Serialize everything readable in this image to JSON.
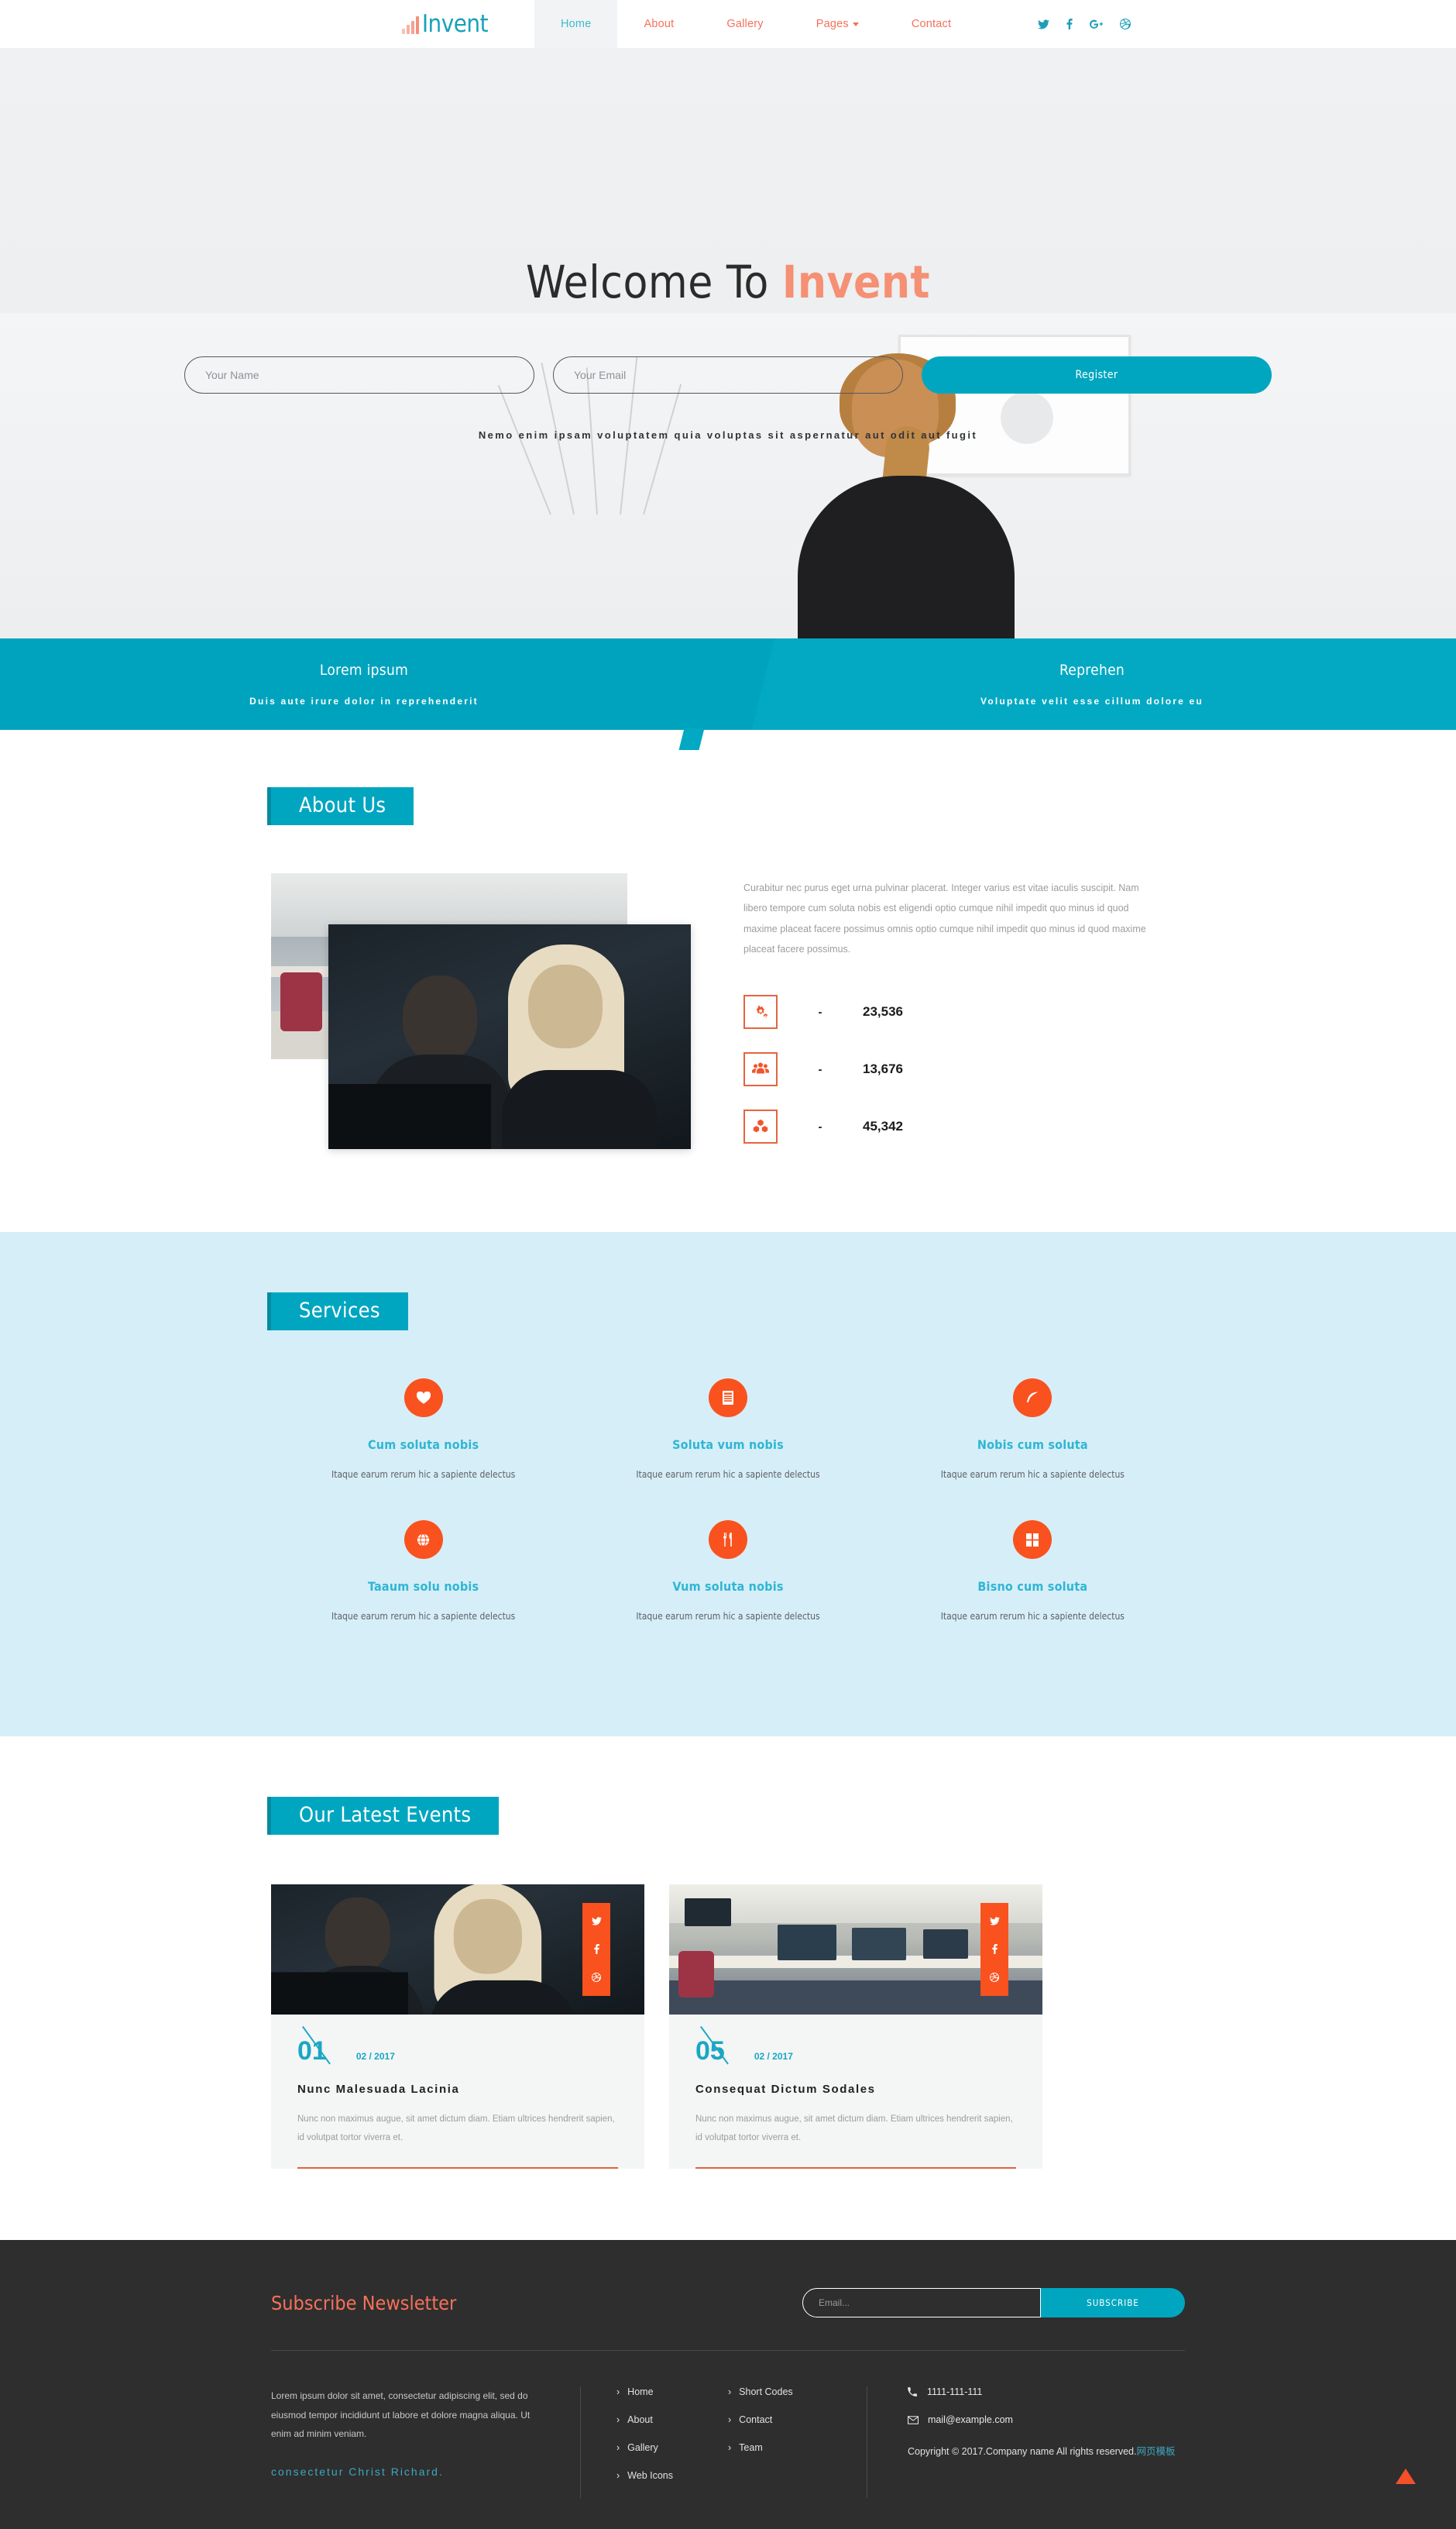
{
  "header": {
    "logo_text": "Invent",
    "logo_icon": "bar-chart-icon",
    "nav": [
      {
        "label": "Home",
        "active": true
      },
      {
        "label": "About",
        "active": false
      },
      {
        "label": "Gallery",
        "active": false
      },
      {
        "label": "Pages",
        "active": false,
        "has_caret": true
      },
      {
        "label": "Contact",
        "active": false
      }
    ],
    "social": [
      {
        "name": "twitter-icon"
      },
      {
        "name": "facebook-icon"
      },
      {
        "name": "google-plus-icon"
      },
      {
        "name": "dribbble-icon"
      }
    ]
  },
  "banner": {
    "title_plain": "Welcome To ",
    "title_accent": "Invent",
    "name_placeholder": "Your Name",
    "email_placeholder": "Your Email",
    "register_label": "Register",
    "subtitle": "Nemo enim ipsam voluptatem quia voluptas sit aspernatur aut odit aut fugit"
  },
  "tealbar": [
    {
      "title": "Lorem ipsum",
      "text": "Duis aute irure dolor in reprehenderit"
    },
    {
      "title": "Reprehen",
      "text": "Voluptate velit esse cillum dolore eu"
    }
  ],
  "about": {
    "title": "About Us",
    "paragraph": "Curabitur nec purus eget urna pulvinar placerat. Integer varius est vitae iaculis suscipit. Nam libero tempore cum soluta nobis est eligendi optio cumque nihil impedit quo minus id quod maxime placeat facere possimus omnis optio cumque nihil impedit quo minus id quod maxime placeat facere possimus.",
    "stats": [
      {
        "icon": "cogs-icon",
        "dash": "-",
        "value": "23,536"
      },
      {
        "icon": "users-icon",
        "dash": "-",
        "value": "13,676"
      },
      {
        "icon": "cubes-icon",
        "dash": "-",
        "value": "45,342"
      }
    ]
  },
  "services": {
    "title": "Services",
    "items": [
      {
        "icon": "heart-icon",
        "title": "Cum soluta nobis",
        "text": "Itaque earum rerum hic a sapiente delectus"
      },
      {
        "icon": "list-alt-icon",
        "title": "Soluta vum nobis",
        "text": "Itaque earum rerum hic a sapiente delectus"
      },
      {
        "icon": "feather-icon",
        "title": "Nobis cum soluta",
        "text": "Itaque earum rerum hic a sapiente delectus"
      },
      {
        "icon": "globe-icon",
        "title": "Taaum solu nobis",
        "text": "Itaque earum rerum hic a sapiente delectus"
      },
      {
        "icon": "cutlery-icon",
        "title": "Vum soluta nobis",
        "text": "Itaque earum rerum hic a sapiente delectus"
      },
      {
        "icon": "grid-icon",
        "title": "Bisno cum soluta",
        "text": "Itaque earum rerum hic a sapiente delectus"
      }
    ]
  },
  "events": {
    "title": "Our Latest Events",
    "share_icons": [
      "twitter-icon",
      "facebook-icon",
      "dribbble-icon"
    ],
    "cards": [
      {
        "number": "01",
        "date": "02 / 2017",
        "title": "Nunc Malesuada Lacinia",
        "text": "Nunc non maximus augue, sit amet dictum diam. Etiam ultrices hendrerit sapien, id volutpat tortor viverra et."
      },
      {
        "number": "05",
        "date": "02 / 2017",
        "title": "Consequat Dictum Sodales",
        "text": "Nunc non maximus augue, sit amet dictum diam. Etiam ultrices hendrerit sapien, id volutpat tortor viverra et."
      }
    ]
  },
  "footer": {
    "subscribe_title": "Subscribe Newsletter",
    "email_placeholder": "Email...",
    "subscribe_button": "SUBSCRIBE",
    "about_text": "Lorem ipsum dolor sit amet, consectetur adipiscing elit, sed do eiusmod tempor incididunt ut labore et dolore magna aliqua. Ut enim ad minim veniam.",
    "signature_prefix": "consectetur ",
    "signature_name": "Christ Richard.",
    "links_col1": [
      "Home",
      "About",
      "Gallery",
      "Web Icons"
    ],
    "links_col2": [
      "Short Codes",
      "Contact",
      "Team"
    ],
    "phone": "1111-111-111",
    "phone_icon": "phone-icon",
    "email": "mail@example.com",
    "email_icon": "envelope-icon",
    "copyright_text": "Copyright © 2017.Company name All rights reserved.",
    "copyright_link": "网页模板",
    "to_top_icon": "triangle-up-icon"
  },
  "colors": {
    "teal": "#00a6c0",
    "orange": "#f9521e",
    "salmon": "#f4705a",
    "light_blue": "#d6eef7",
    "footer_bg": "#2e2e2e"
  }
}
